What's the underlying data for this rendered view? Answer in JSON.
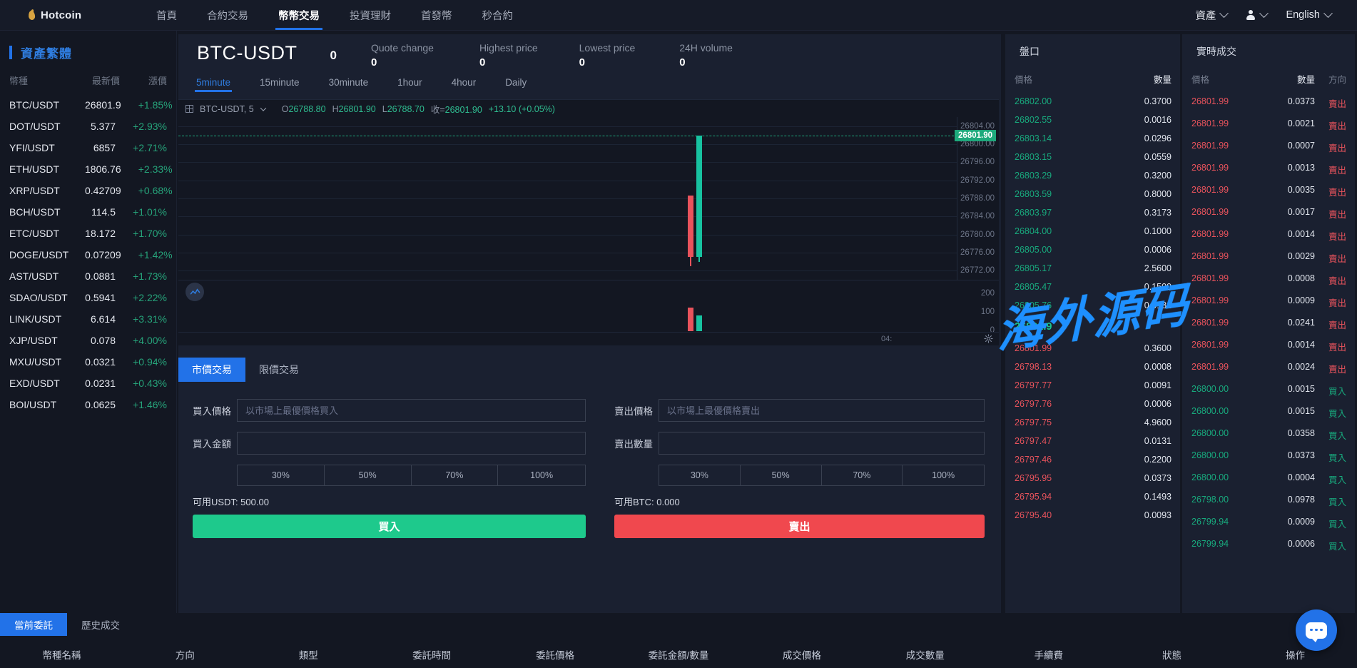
{
  "navbar": {
    "brand": "Hotcoin",
    "brand_icon": "flame-icon",
    "items": [
      {
        "label": "首頁",
        "active": false
      },
      {
        "label": "合約交易",
        "active": false
      },
      {
        "label": "幣幣交易",
        "active": true
      },
      {
        "label": "投資理財",
        "active": false
      },
      {
        "label": "首發幣",
        "active": false
      },
      {
        "label": "秒合約",
        "active": false
      }
    ],
    "assets_label": "資產",
    "language_label": "English",
    "accent_color": "#2272e8"
  },
  "sidebar": {
    "title": "資產繁體",
    "columns": {
      "symbol": "幣種",
      "price": "最新價",
      "change": "漲價"
    },
    "rows": [
      {
        "symbol": "BTC/USDT",
        "price": "26801.9",
        "change": "+1.85%"
      },
      {
        "symbol": "DOT/USDT",
        "price": "5.377",
        "change": "+2.93%"
      },
      {
        "symbol": "YFI/USDT",
        "price": "6857",
        "change": "+2.71%"
      },
      {
        "symbol": "ETH/USDT",
        "price": "1806.76",
        "change": "+2.33%"
      },
      {
        "symbol": "XRP/USDT",
        "price": "0.42709",
        "change": "+0.68%"
      },
      {
        "symbol": "BCH/USDT",
        "price": "114.5",
        "change": "+1.01%"
      },
      {
        "symbol": "ETC/USDT",
        "price": "18.172",
        "change": "+1.70%"
      },
      {
        "symbol": "DOGE/USDT",
        "price": "0.07209",
        "change": "+1.42%"
      },
      {
        "symbol": "AST/USDT",
        "price": "0.0881",
        "change": "+1.73%"
      },
      {
        "symbol": "SDAO/USDT",
        "price": "0.5941",
        "change": "+2.22%"
      },
      {
        "symbol": "LINK/USDT",
        "price": "6.614",
        "change": "+3.31%"
      },
      {
        "symbol": "XJP/USDT",
        "price": "0.078",
        "change": "+4.00%"
      },
      {
        "symbol": "MXU/USDT",
        "price": "0.0321",
        "change": "+0.94%"
      },
      {
        "symbol": "EXD/USDT",
        "price": "0.0231",
        "change": "+0.43%"
      },
      {
        "symbol": "BOI/USDT",
        "price": "0.0625",
        "change": "+1.46%"
      }
    ]
  },
  "ticker": {
    "pair": "BTC-USDT",
    "last_price": "0",
    "stats": [
      {
        "label": "Quote change",
        "value": "0"
      },
      {
        "label": "Highest price",
        "value": "0"
      },
      {
        "label": "Lowest price",
        "value": "0"
      },
      {
        "label": "24H volume",
        "value": "0"
      }
    ]
  },
  "timeframes": [
    {
      "label": "5minute",
      "active": true
    },
    {
      "label": "15minute",
      "active": false
    },
    {
      "label": "30minute",
      "active": false
    },
    {
      "label": "1hour",
      "active": false
    },
    {
      "label": "4hour",
      "active": false
    },
    {
      "label": "Daily",
      "active": false
    }
  ],
  "chart_data": {
    "type": "line",
    "title": "BTC-USDT, 5",
    "symbol_label": "BTC-USDT, 5",
    "ohlc": {
      "open_label": "O",
      "open": "26788.80",
      "high_label": "H",
      "high": "26801.90",
      "low_label": "L",
      "low": "26788.70",
      "close_label": "收=",
      "close": "26801.90",
      "change": "+13.10 (+0.05%)"
    },
    "last_price_badge": "26801.90",
    "price_axis_ticks": [
      "26804.00",
      "26800.00",
      "26796.00",
      "26792.00",
      "26788.00",
      "26784.00",
      "26780.00",
      "26776.00",
      "26772.00"
    ],
    "volume_axis_ticks": [
      "200",
      "100",
      "0"
    ],
    "time_axis_ticks": [
      "04:"
    ],
    "candles": [
      {
        "open": 26788.7,
        "high": 26788.7,
        "low": 26773.0,
        "close": 26775.0,
        "dir": "down"
      },
      {
        "open": 26775.0,
        "high": 26801.9,
        "low": 26774.0,
        "close": 26801.9,
        "dir": "up"
      }
    ],
    "volumes": [
      60,
      40
    ],
    "grid": true,
    "ylim": [
      26770,
      26806
    ]
  },
  "trade_form": {
    "tabs": [
      {
        "label": "市價交易",
        "active": true
      },
      {
        "label": "限價交易",
        "active": false
      }
    ],
    "buy": {
      "price_label": "買入價格",
      "price_placeholder": "以市場上最優價格買入",
      "price_value": "",
      "amount_label": "買入金額",
      "amount_placeholder": "",
      "amount_value": "",
      "percents": [
        "30%",
        "50%",
        "70%",
        "100%"
      ],
      "available": "可用USDT: 500.00",
      "submit": "買入"
    },
    "sell": {
      "price_label": "賣出價格",
      "price_placeholder": "以市場上最優價格賣出",
      "price_value": "",
      "amount_label": "賣出數量",
      "amount_placeholder": "",
      "amount_value": "",
      "percents": [
        "30%",
        "50%",
        "70%",
        "100%"
      ],
      "available": "可用BTC: 0.000",
      "submit": "賣出"
    }
  },
  "order_book": {
    "title": "盤口",
    "columns": {
      "price": "價格",
      "amount": "數量"
    },
    "asks": [
      {
        "price": "26802.00",
        "amount": "0.3700"
      },
      {
        "price": "26802.55",
        "amount": "0.0016"
      },
      {
        "price": "26803.14",
        "amount": "0.0296"
      },
      {
        "price": "26803.15",
        "amount": "0.0559"
      },
      {
        "price": "26803.29",
        "amount": "0.3200"
      },
      {
        "price": "26803.59",
        "amount": "0.8000"
      },
      {
        "price": "26803.97",
        "amount": "0.3173"
      },
      {
        "price": "26804.00",
        "amount": "0.1000"
      },
      {
        "price": "26805.00",
        "amount": "0.0006"
      },
      {
        "price": "26805.17",
        "amount": "2.5600"
      },
      {
        "price": "26805.47",
        "amount": "0.1500"
      },
      {
        "price": "26805.76",
        "amount": "0.0181"
      }
    ],
    "mid_price": "26801.9",
    "bids": [
      {
        "price": "26801.99",
        "amount": "0.3600"
      },
      {
        "price": "26798.13",
        "amount": "0.0008"
      },
      {
        "price": "26797.77",
        "amount": "0.0091"
      },
      {
        "price": "26797.76",
        "amount": "0.0006"
      },
      {
        "price": "26797.75",
        "amount": "4.9600"
      },
      {
        "price": "26797.47",
        "amount": "0.0131"
      },
      {
        "price": "26797.46",
        "amount": "0.2200"
      },
      {
        "price": "26795.95",
        "amount": "0.0373"
      },
      {
        "price": "26795.94",
        "amount": "0.1493"
      },
      {
        "price": "26795.40",
        "amount": "0.0093"
      }
    ]
  },
  "trades": {
    "title": "實時成交",
    "columns": {
      "price": "價格",
      "amount": "數量",
      "direction": "方向"
    },
    "rows": [
      {
        "price": "26801.99",
        "amount": "0.0373",
        "direction": "賣出",
        "side": "sell"
      },
      {
        "price": "26801.99",
        "amount": "0.0021",
        "direction": "賣出",
        "side": "sell"
      },
      {
        "price": "26801.99",
        "amount": "0.0007",
        "direction": "賣出",
        "side": "sell"
      },
      {
        "price": "26801.99",
        "amount": "0.0013",
        "direction": "賣出",
        "side": "sell"
      },
      {
        "price": "26801.99",
        "amount": "0.0035",
        "direction": "賣出",
        "side": "sell"
      },
      {
        "price": "26801.99",
        "amount": "0.0017",
        "direction": "賣出",
        "side": "sell"
      },
      {
        "price": "26801.99",
        "amount": "0.0014",
        "direction": "賣出",
        "side": "sell"
      },
      {
        "price": "26801.99",
        "amount": "0.0029",
        "direction": "賣出",
        "side": "sell"
      },
      {
        "price": "26801.99",
        "amount": "0.0008",
        "direction": "賣出",
        "side": "sell"
      },
      {
        "price": "26801.99",
        "amount": "0.0009",
        "direction": "賣出",
        "side": "sell"
      },
      {
        "price": "26801.99",
        "amount": "0.0241",
        "direction": "賣出",
        "side": "sell"
      },
      {
        "price": "26801.99",
        "amount": "0.0014",
        "direction": "賣出",
        "side": "sell"
      },
      {
        "price": "26801.99",
        "amount": "0.0024",
        "direction": "賣出",
        "side": "sell"
      },
      {
        "price": "26800.00",
        "amount": "0.0015",
        "direction": "買入",
        "side": "buy"
      },
      {
        "price": "26800.00",
        "amount": "0.0015",
        "direction": "買入",
        "side": "buy"
      },
      {
        "price": "26800.00",
        "amount": "0.0358",
        "direction": "買入",
        "side": "buy"
      },
      {
        "price": "26800.00",
        "amount": "0.0373",
        "direction": "買入",
        "side": "buy"
      },
      {
        "price": "26800.00",
        "amount": "0.0004",
        "direction": "買入",
        "side": "buy"
      },
      {
        "price": "26798.00",
        "amount": "0.0978",
        "direction": "買入",
        "side": "buy"
      },
      {
        "price": "26799.94",
        "amount": "0.0009",
        "direction": "買入",
        "side": "buy"
      },
      {
        "price": "26799.94",
        "amount": "0.0006",
        "direction": "買入",
        "side": "buy"
      }
    ]
  },
  "bottom": {
    "tabs": [
      {
        "label": "當前委託",
        "active": true
      },
      {
        "label": "歷史成交",
        "active": false
      }
    ],
    "columns": [
      "幣種名稱",
      "方向",
      "類型",
      "委託時間",
      "委託價格",
      "委託金額/數量",
      "成交價格",
      "成交數量",
      "手續費",
      "狀態",
      "操作"
    ]
  },
  "watermark": "海外源码"
}
